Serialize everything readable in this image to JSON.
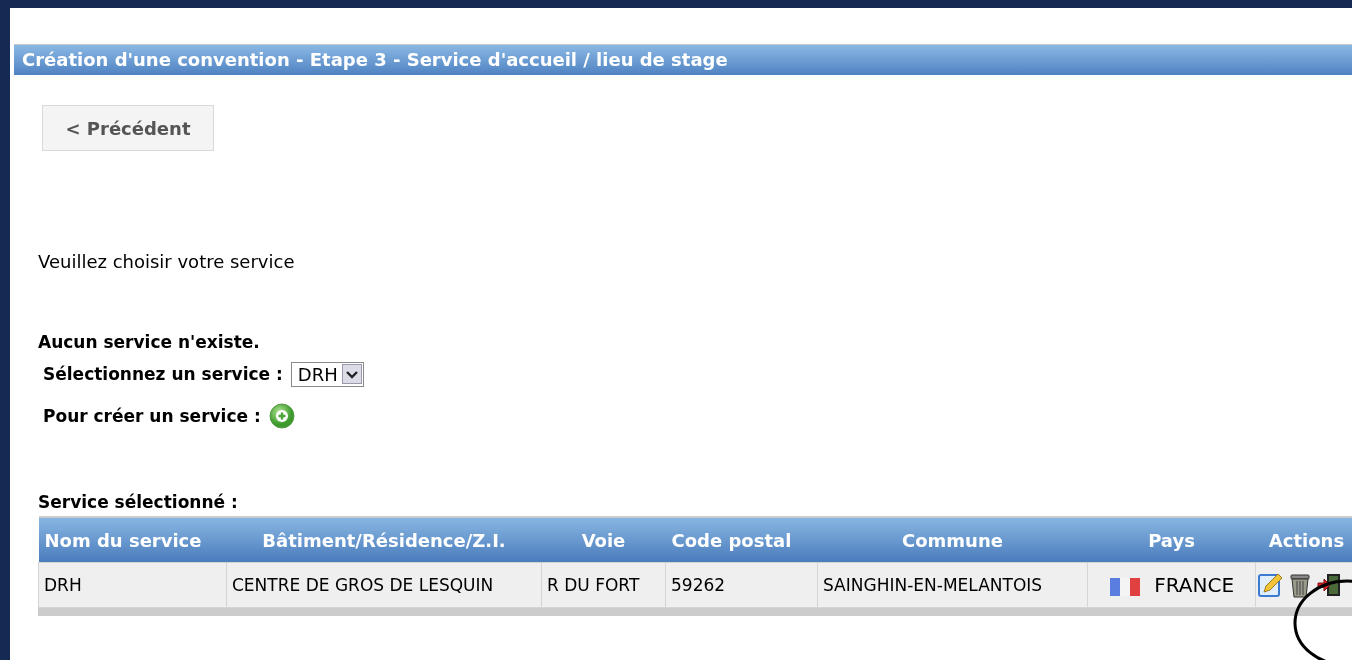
{
  "header": {
    "title": "Création d'une convention - Etape 3 - Service d'accueil / lieu de stage"
  },
  "back_button": "< Précédent",
  "instruction": "Veuillez choisir votre service",
  "notice": "Aucun service n'existe.",
  "select_service": {
    "label": "Sélectionnez un service :",
    "value": "DRH"
  },
  "create_service": {
    "label": "Pour créer un service :"
  },
  "selected_section": {
    "title": "Service sélectionné :",
    "table": {
      "columns": [
        "Nom du service",
        "Bâtiment/Résidence/Z.I.",
        "Voie",
        "Code postal",
        "Commune",
        "Pays",
        "Actions"
      ],
      "rows": [
        {
          "name": "DRH",
          "building": "CENTRE DE GROS DE LESQUIN",
          "street": "R DU FORT",
          "postal_code": "59262",
          "city": "SAINGHIN-EN-MELANTOIS",
          "country": "FRANCE"
        }
      ]
    }
  }
}
